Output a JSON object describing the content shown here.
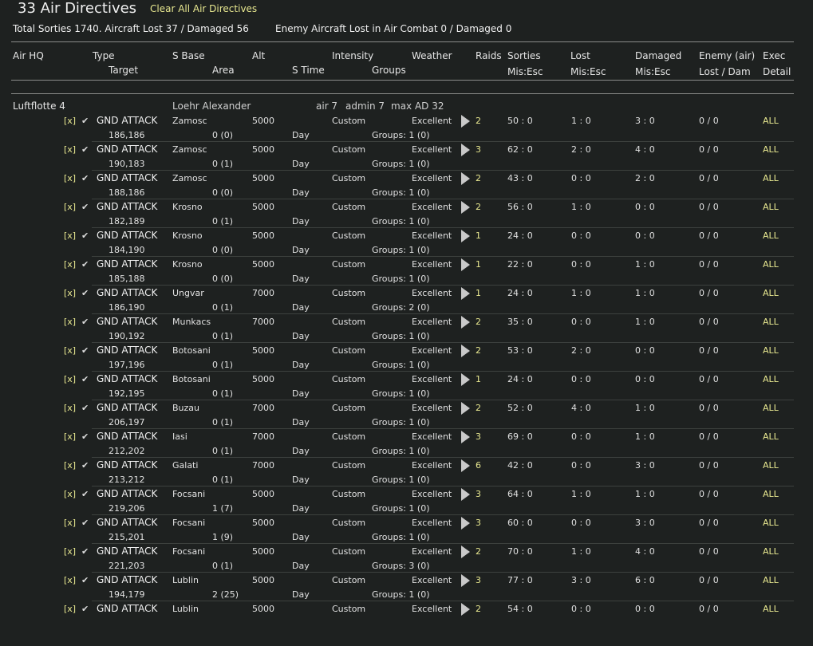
{
  "header": {
    "title": "33 Air Directives",
    "clear_label": "Clear All Air Directives",
    "total_summary": "Total Sorties 1740. Aircraft Lost 37 / Damaged 56",
    "enemy_summary": "Enemy Aircraft Lost in Air Combat 0 / Damaged 0"
  },
  "columns": {
    "air_hq": "Air HQ",
    "type": "Type",
    "target": "Target",
    "s_base": "S Base",
    "area": "Area",
    "alt": "Alt",
    "s_time": "S Time",
    "intensity": "Intensity",
    "groups": "Groups",
    "weather": "Weather",
    "raids": "Raids",
    "sorties": "Sorties",
    "sorties_sub": "Mis:Esc",
    "lost": "Lost",
    "lost_sub": "Mis:Esc",
    "damaged": "Damaged",
    "damaged_sub": "Mis:Esc",
    "enemy": "Enemy (air)",
    "enemy_sub": "Lost / Dam",
    "exec": "Exec",
    "exec_sub": "Detail"
  },
  "hq": {
    "name": "Luftflotte 4",
    "commander": "Loehr Alexander",
    "air": "air 7",
    "admin": "admin 7",
    "max_ad": "max AD 32"
  },
  "rows": [
    {
      "x": "[x]",
      "check": "✔",
      "mission": "GND ATTACK",
      "target": "186,186",
      "base": "Zamosc",
      "area": "0 (0)",
      "alt": "5000",
      "time": "Day",
      "intensity": "Custom",
      "groups": "Groups: 1  (0)",
      "weather": "Excellent",
      "raids": "2",
      "sorties": "50 : 0",
      "lost": "1 : 0",
      "damaged": "3 : 0",
      "enemy": "0 / 0",
      "exec": "ALL"
    },
    {
      "x": "[x]",
      "check": "✔",
      "mission": "GND ATTACK",
      "target": "190,183",
      "base": "Zamosc",
      "area": "0 (1)",
      "alt": "5000",
      "time": "Day",
      "intensity": "Custom",
      "groups": "Groups: 1  (0)",
      "weather": "Excellent",
      "raids": "3",
      "sorties": "62 : 0",
      "lost": "2 : 0",
      "damaged": "4 : 0",
      "enemy": "0 / 0",
      "exec": "ALL"
    },
    {
      "x": "[x]",
      "check": "✔",
      "mission": "GND ATTACK",
      "target": "188,186",
      "base": "Zamosc",
      "area": "0 (0)",
      "alt": "5000",
      "time": "Day",
      "intensity": "Custom",
      "groups": "Groups: 1  (0)",
      "weather": "Excellent",
      "raids": "2",
      "sorties": "43 : 0",
      "lost": "0 : 0",
      "damaged": "2 : 0",
      "enemy": "0 / 0",
      "exec": "ALL"
    },
    {
      "x": "[x]",
      "check": "✔",
      "mission": "GND ATTACK",
      "target": "182,189",
      "base": "Krosno",
      "area": "0 (1)",
      "alt": "5000",
      "time": "Day",
      "intensity": "Custom",
      "groups": "Groups: 1  (0)",
      "weather": "Excellent",
      "raids": "2",
      "sorties": "56 : 0",
      "lost": "1 : 0",
      "damaged": "0 : 0",
      "enemy": "0 / 0",
      "exec": "ALL"
    },
    {
      "x": "[x]",
      "check": "✔",
      "mission": "GND ATTACK",
      "target": "184,190",
      "base": "Krosno",
      "area": "0 (0)",
      "alt": "5000",
      "time": "Day",
      "intensity": "Custom",
      "groups": "Groups: 1  (0)",
      "weather": "Excellent",
      "raids": "1",
      "sorties": "24 : 0",
      "lost": "0 : 0",
      "damaged": "0 : 0",
      "enemy": "0 / 0",
      "exec": "ALL"
    },
    {
      "x": "[x]",
      "check": "✔",
      "mission": "GND ATTACK",
      "target": "185,188",
      "base": "Krosno",
      "area": "0 (0)",
      "alt": "5000",
      "time": "Day",
      "intensity": "Custom",
      "groups": "Groups: 1  (0)",
      "weather": "Excellent",
      "raids": "1",
      "sorties": "22 : 0",
      "lost": "0 : 0",
      "damaged": "1 : 0",
      "enemy": "0 / 0",
      "exec": "ALL"
    },
    {
      "x": "[x]",
      "check": "✔",
      "mission": "GND ATTACK",
      "target": "186,190",
      "base": "Ungvar",
      "area": "0 (1)",
      "alt": "7000",
      "time": "Day",
      "intensity": "Custom",
      "groups": "Groups: 2  (0)",
      "weather": "Excellent",
      "raids": "1",
      "sorties": "24 : 0",
      "lost": "1 : 0",
      "damaged": "1 : 0",
      "enemy": "0 / 0",
      "exec": "ALL"
    },
    {
      "x": "[x]",
      "check": "✔",
      "mission": "GND ATTACK",
      "target": "190,192",
      "base": "Munkacs",
      "area": "0 (1)",
      "alt": "7000",
      "time": "Day",
      "intensity": "Custom",
      "groups": "Groups: 1  (0)",
      "weather": "Excellent",
      "raids": "2",
      "sorties": "35 : 0",
      "lost": "0 : 0",
      "damaged": "1 : 0",
      "enemy": "0 / 0",
      "exec": "ALL"
    },
    {
      "x": "[x]",
      "check": "✔",
      "mission": "GND ATTACK",
      "target": "197,196",
      "base": "Botosani",
      "area": "0 (1)",
      "alt": "5000",
      "time": "Day",
      "intensity": "Custom",
      "groups": "Groups: 1  (0)",
      "weather": "Excellent",
      "raids": "2",
      "sorties": "53 : 0",
      "lost": "2 : 0",
      "damaged": "0 : 0",
      "enemy": "0 / 0",
      "exec": "ALL"
    },
    {
      "x": "[x]",
      "check": "✔",
      "mission": "GND ATTACK",
      "target": "192,195",
      "base": "Botosani",
      "area": "0 (1)",
      "alt": "5000",
      "time": "Day",
      "intensity": "Custom",
      "groups": "Groups: 1  (0)",
      "weather": "Excellent",
      "raids": "1",
      "sorties": "24 : 0",
      "lost": "0 : 0",
      "damaged": "0 : 0",
      "enemy": "0 / 0",
      "exec": "ALL"
    },
    {
      "x": "[x]",
      "check": "✔",
      "mission": "GND ATTACK",
      "target": "206,197",
      "base": "Buzau",
      "area": "0 (1)",
      "alt": "7000",
      "time": "Day",
      "intensity": "Custom",
      "groups": "Groups: 1  (0)",
      "weather": "Excellent",
      "raids": "2",
      "sorties": "52 : 0",
      "lost": "4 : 0",
      "damaged": "1 : 0",
      "enemy": "0 / 0",
      "exec": "ALL"
    },
    {
      "x": "[x]",
      "check": "✔",
      "mission": "GND ATTACK",
      "target": "212,202",
      "base": "Iasi",
      "area": "0 (1)",
      "alt": "7000",
      "time": "Day",
      "intensity": "Custom",
      "groups": "Groups: 1  (0)",
      "weather": "Excellent",
      "raids": "3",
      "sorties": "69 : 0",
      "lost": "0 : 0",
      "damaged": "1 : 0",
      "enemy": "0 / 0",
      "exec": "ALL"
    },
    {
      "x": "[x]",
      "check": "✔",
      "mission": "GND ATTACK",
      "target": "213,212",
      "base": "Galati",
      "area": "0 (1)",
      "alt": "7000",
      "time": "Day",
      "intensity": "Custom",
      "groups": "Groups: 1  (0)",
      "weather": "Excellent",
      "raids": "6",
      "sorties": "42 : 0",
      "lost": "0 : 0",
      "damaged": "3 : 0",
      "enemy": "0 / 0",
      "exec": "ALL"
    },
    {
      "x": "[x]",
      "check": "✔",
      "mission": "GND ATTACK",
      "target": "219,206",
      "base": "Focsani",
      "area": "1 (7)",
      "alt": "5000",
      "time": "Day",
      "intensity": "Custom",
      "groups": "Groups: 1  (0)",
      "weather": "Excellent",
      "raids": "3",
      "sorties": "64 : 0",
      "lost": "1 : 0",
      "damaged": "1 : 0",
      "enemy": "0 / 0",
      "exec": "ALL"
    },
    {
      "x": "[x]",
      "check": "✔",
      "mission": "GND ATTACK",
      "target": "215,201",
      "base": "Focsani",
      "area": "1 (9)",
      "alt": "5000",
      "time": "Day",
      "intensity": "Custom",
      "groups": "Groups: 1  (0)",
      "weather": "Excellent",
      "raids": "3",
      "sorties": "60 : 0",
      "lost": "0 : 0",
      "damaged": "3 : 0",
      "enemy": "0 / 0",
      "exec": "ALL"
    },
    {
      "x": "[x]",
      "check": "✔",
      "mission": "GND ATTACK",
      "target": "221,203",
      "base": "Focsani",
      "area": "0 (1)",
      "alt": "5000",
      "time": "Day",
      "intensity": "Custom",
      "groups": "Groups: 3  (0)",
      "weather": "Excellent",
      "raids": "2",
      "sorties": "70 : 0",
      "lost": "1 : 0",
      "damaged": "4 : 0",
      "enemy": "0 / 0",
      "exec": "ALL"
    },
    {
      "x": "[x]",
      "check": "✔",
      "mission": "GND ATTACK",
      "target": "194,179",
      "base": "Lublin",
      "area": "2 (25)",
      "alt": "5000",
      "time": "Day",
      "intensity": "Custom",
      "groups": "Groups: 1  (0)",
      "weather": "Excellent",
      "raids": "3",
      "sorties": "77 : 0",
      "lost": "3 : 0",
      "damaged": "6 : 0",
      "enemy": "0 / 0",
      "exec": "ALL"
    },
    {
      "x": "[x]",
      "check": "✔",
      "mission": "GND ATTACK",
      "target": "",
      "base": "Lublin",
      "area": "",
      "alt": "5000",
      "time": "",
      "intensity": "Custom",
      "groups": "",
      "weather": "Excellent",
      "raids": "2",
      "sorties": "54 : 0",
      "lost": "0 : 0",
      "damaged": "0 : 0",
      "enemy": "0 / 0",
      "exec": "ALL"
    }
  ]
}
